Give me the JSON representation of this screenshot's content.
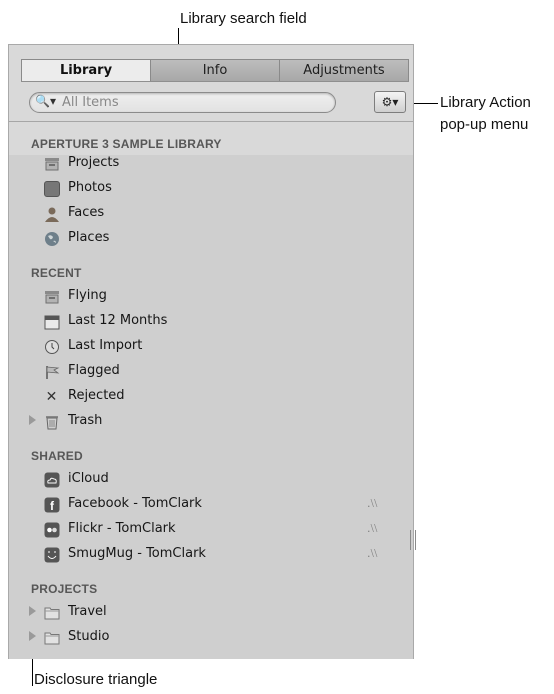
{
  "callouts": {
    "search_field": "Library search field",
    "action_menu_line1": "Library Action",
    "action_menu_line2": "pop-up menu",
    "disclosure": "Disclosure triangle"
  },
  "tabs": [
    {
      "label": "Library",
      "active": true
    },
    {
      "label": "Info",
      "active": false
    },
    {
      "label": "Adjustments",
      "active": false
    }
  ],
  "search": {
    "placeholder": "All Items",
    "icon": "magnifier-dropdown-icon"
  },
  "action_menu": {
    "icon": "gear-dropdown-icon"
  },
  "sections": [
    {
      "title": "APERTURE 3 SAMPLE LIBRARY",
      "items": [
        {
          "label": "Projects",
          "icon": "projects-icon"
        },
        {
          "label": "Photos",
          "icon": "photos-icon"
        },
        {
          "label": "Faces",
          "icon": "faces-icon"
        },
        {
          "label": "Places",
          "icon": "places-icon"
        }
      ]
    },
    {
      "title": "RECENT",
      "items": [
        {
          "label": "Flying",
          "icon": "project-box-icon"
        },
        {
          "label": "Last 12 Months",
          "icon": "calendar-icon"
        },
        {
          "label": "Last Import",
          "icon": "import-clock-icon"
        },
        {
          "label": "Flagged",
          "icon": "flag-icon"
        },
        {
          "label": "Rejected",
          "icon": "reject-x-icon"
        },
        {
          "label": "Trash",
          "icon": "trash-icon"
        }
      ]
    },
    {
      "title": "SHARED",
      "items": [
        {
          "label": "iCloud",
          "icon": "icloud-icon"
        },
        {
          "label": "Facebook - TomClark",
          "icon": "facebook-icon"
        },
        {
          "label": "Flickr - TomClark",
          "icon": "flickr-icon"
        },
        {
          "label": "SmugMug - TomClark",
          "icon": "smugmug-icon"
        }
      ]
    },
    {
      "title": "PROJECTS",
      "items": [
        {
          "label": "Travel",
          "icon": "folder-icon"
        },
        {
          "label": "Studio",
          "icon": "folder-icon"
        }
      ]
    }
  ],
  "colors": {
    "panel_bg": "#cfcfcf",
    "section_header": "#575757",
    "active_tab": "#ececec"
  }
}
